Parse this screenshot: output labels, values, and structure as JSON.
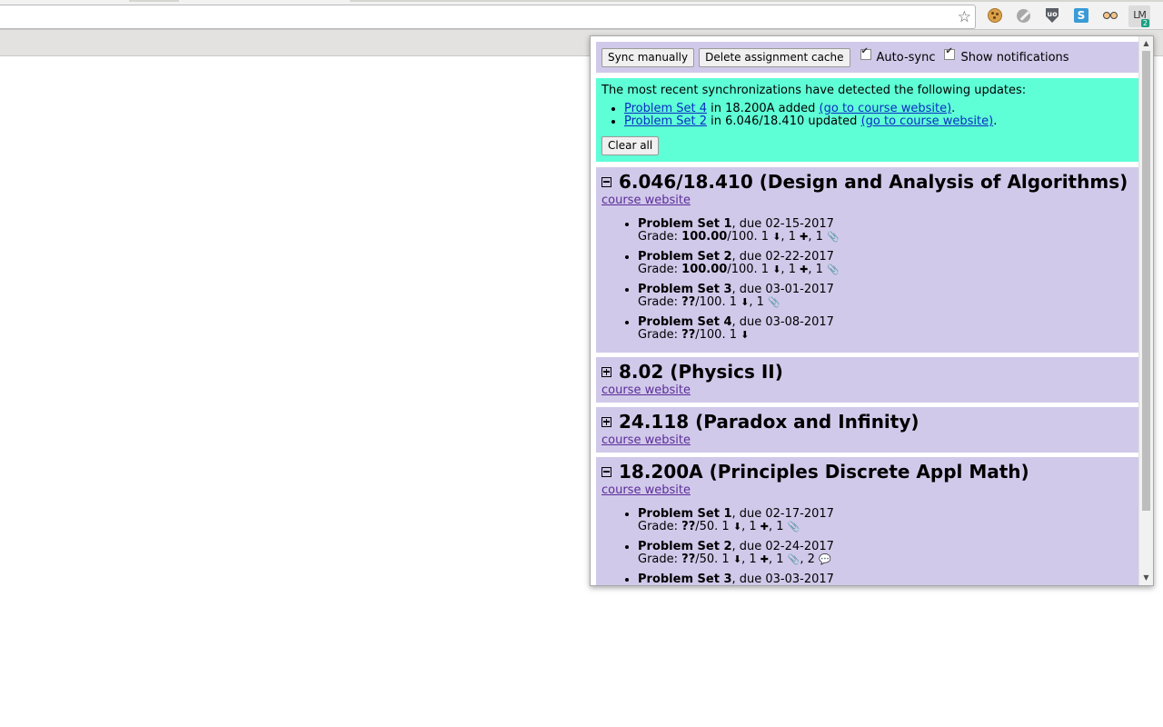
{
  "browser": {
    "star_icon": "☆",
    "extensions": [
      {
        "name": "cookie-icon"
      },
      {
        "name": "leaf-icon"
      },
      {
        "name": "ublock-icon",
        "glyph": "uo"
      },
      {
        "name": "skype-icon",
        "glyph": "S"
      },
      {
        "name": "owl-icon"
      },
      {
        "name": "lm-icon",
        "glyph": "LM",
        "badge": "2"
      }
    ]
  },
  "popup": {
    "controls": {
      "sync_label": "Sync manually",
      "delete_label": "Delete assignment cache",
      "autosync_label": "Auto-sync",
      "notifications_label": "Show notifications"
    },
    "updates": {
      "intro": "The most recent synchronizations have detected the following updates:",
      "items": [
        {
          "assignment": "Problem Set 4",
          "course_text": " in 18.200A added ",
          "website": "(go to course website)",
          "end": "."
        },
        {
          "assignment": "Problem Set 2",
          "course_text": " in 6.046/18.410 updated ",
          "website": "(go to course website)",
          "end": "."
        }
      ],
      "clear_label": "Clear all"
    },
    "courses": [
      {
        "title": "6.046/18.410 (Design and Analysis of Algorithms)",
        "website": "course website",
        "expanded": true,
        "assignments": [
          {
            "name": "Problem Set 1",
            "due": ", due 02-15-2017",
            "grade_prefix": "Grade: ",
            "grade": "100.00",
            "grade_suffix": "/100. 1 ",
            "icons": "1 ⬇, 1 ✚, 1 📎"
          },
          {
            "name": "Problem Set 2",
            "due": ", due 02-22-2017",
            "grade_prefix": "Grade: ",
            "grade": "100.00",
            "grade_suffix": "/100. 1 "
          },
          {
            "name": "Problem Set 3",
            "due": ", due 03-01-2017",
            "grade_prefix": "Grade: ",
            "grade": "??",
            "grade_suffix": "/100. 1 "
          },
          {
            "name": "Problem Set 4",
            "due": ", due 03-08-2017",
            "grade_prefix": "Grade: ",
            "grade": "??",
            "grade_suffix": "/100. 1 "
          }
        ]
      },
      {
        "title": "8.02 (Physics II)",
        "website": "course website",
        "expanded": false
      },
      {
        "title": "24.118 (Paradox and Infinity)",
        "website": "course website",
        "expanded": false
      },
      {
        "title": "18.200A (Principles Discrete Appl Math)",
        "website": "course website",
        "expanded": true,
        "assignments": [
          {
            "name": "Problem Set 1",
            "due": ", due 02-17-2017",
            "grade_prefix": "Grade: ",
            "grade": "??",
            "grade_suffix": "/50. 1 "
          },
          {
            "name": "Problem Set 2",
            "due": ", due 02-24-2017",
            "grade_prefix": "Grade: ",
            "grade": "??",
            "grade_suffix": "/50. 1 "
          },
          {
            "name": "Problem Set 3",
            "due": ", due 03-03-2017"
          }
        ]
      }
    ],
    "glyphs": {
      "download": "⬇",
      "puzzle": "✚",
      "clip": "📎",
      "comment": "💬",
      "sep_comma": ", ",
      "one": "1 ",
      "two": "2 "
    }
  }
}
